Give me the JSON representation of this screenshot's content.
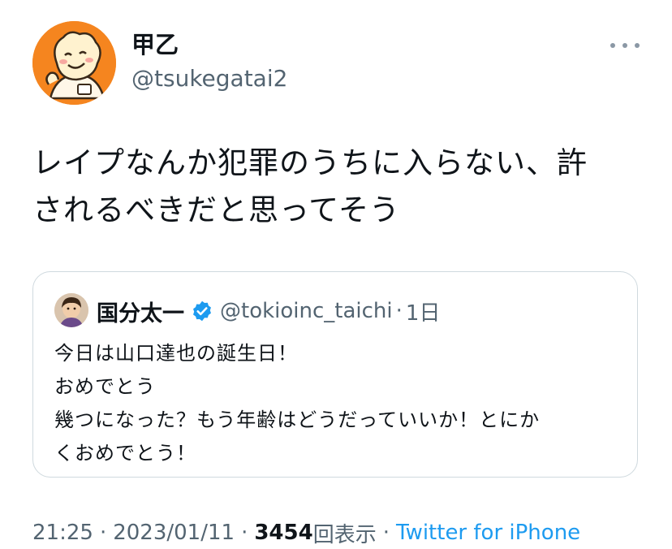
{
  "author": {
    "name": "甲乙",
    "handle": "@tsukegatai2",
    "avatar_icon": "cartoon-character-avatar",
    "avatar_bg": "#f5851f"
  },
  "more_icon": "more-horizontal-icon",
  "tweet": {
    "lines": [
      "レイプなんか犯罪のうちに入らない、許",
      "されるべきだと思ってそう"
    ]
  },
  "quoted": {
    "avatar_icon": "child-photo-avatar",
    "name": "国分太一",
    "verified_icon": "verified-badge-icon",
    "verified_color": "#1d9bf0",
    "handle": "@tokioinc_taichi",
    "separator": "·",
    "time": "1日",
    "lines": [
      "今日は山口達也の誕生日！",
      "おめでとう",
      "幾つになった？もう年齢はどうだっていいか！とにか",
      "くおめでとう！"
    ]
  },
  "meta": {
    "time": "21:25",
    "sep1": "·",
    "date": "2023/01/11",
    "sep2": "·",
    "views_count": "3454",
    "views_label": "回表示",
    "sep3": "·",
    "source": "Twitter for iPhone"
  },
  "colors": {
    "text": "#0f1419",
    "secondary": "#536471",
    "link": "#1d9bf0",
    "border": "#cfd9de"
  }
}
